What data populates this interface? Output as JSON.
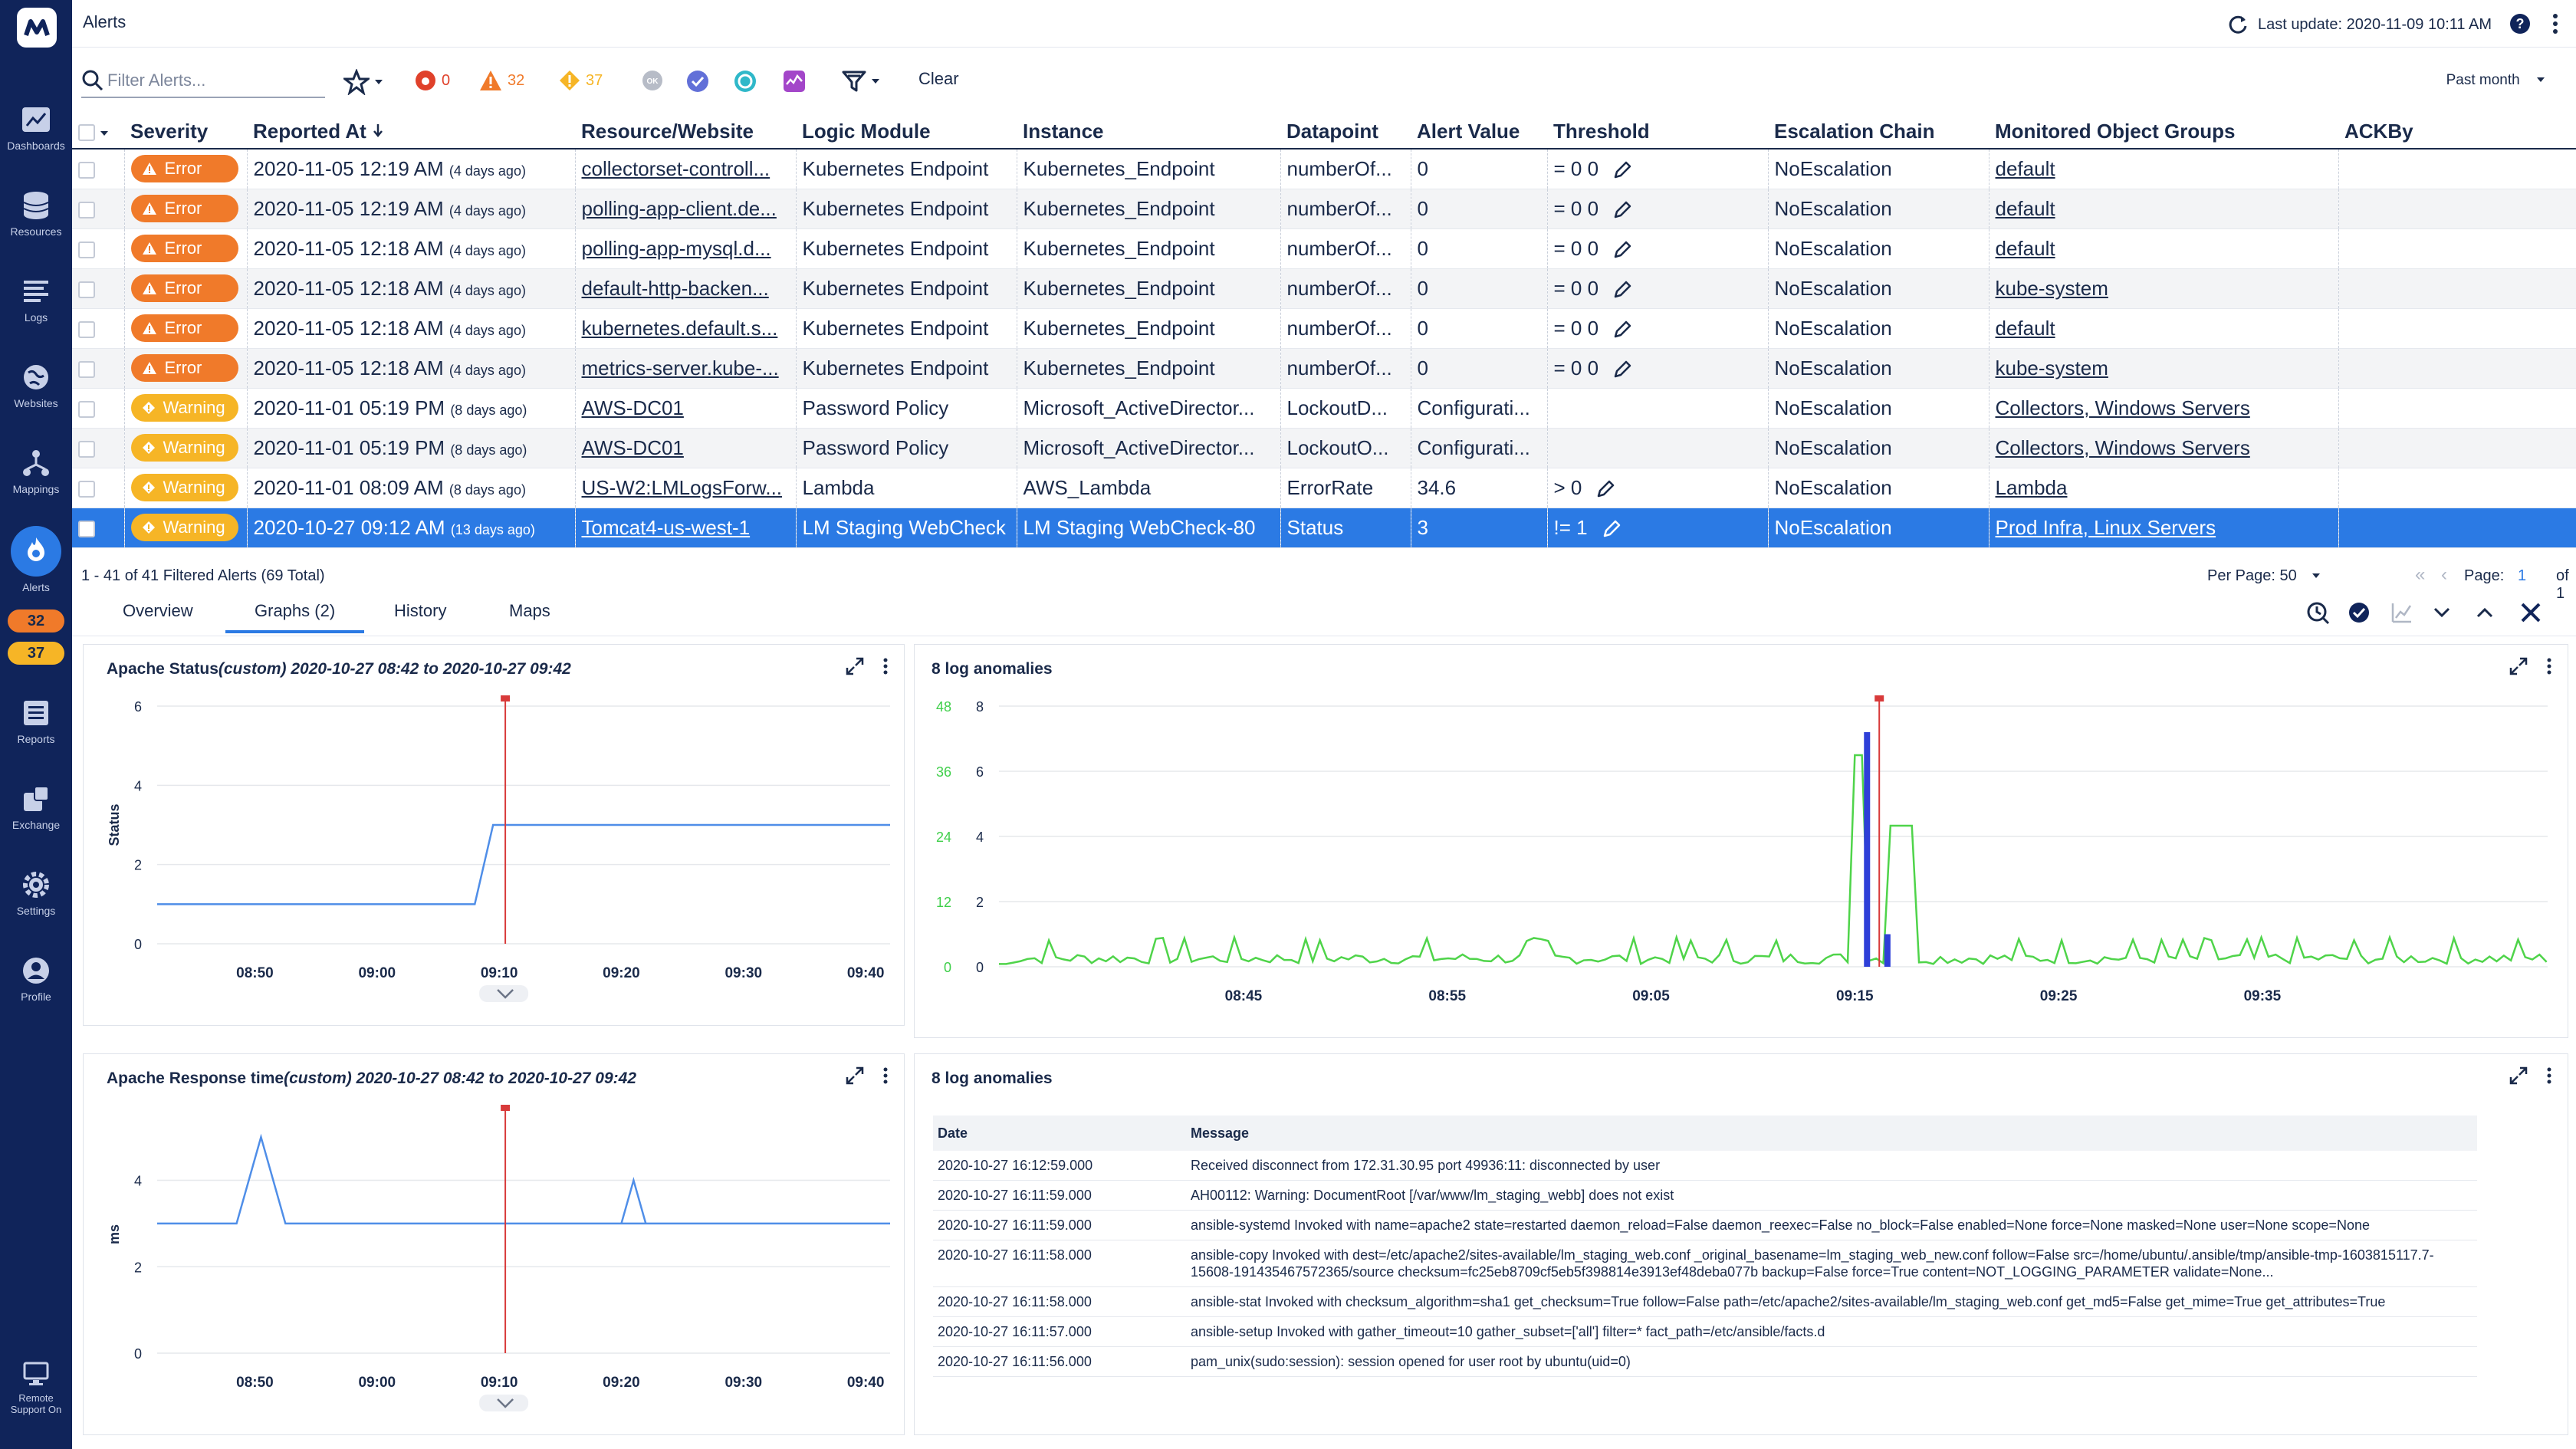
{
  "app": {
    "title": "Alerts",
    "last_update": "Last update: 2020-11-09 10:11 AM"
  },
  "sidebar": {
    "items": [
      {
        "label": "Dashboards"
      },
      {
        "label": "Resources"
      },
      {
        "label": "Logs"
      },
      {
        "label": "Websites"
      },
      {
        "label": "Mappings"
      },
      {
        "label": "Alerts"
      },
      {
        "label": "Reports"
      },
      {
        "label": "Exchange"
      },
      {
        "label": "Settings"
      },
      {
        "label": "Profile"
      },
      {
        "label": "Remote Support On"
      }
    ],
    "badges": {
      "orange": "32",
      "yellow": "37"
    }
  },
  "toolbar": {
    "filter_placeholder": "Filter Alerts...",
    "critical_count": "0",
    "error_count": "32",
    "warning_count": "37",
    "ok_label": "OK",
    "clear_label": "Clear",
    "range_label": "Past month"
  },
  "table": {
    "headers": [
      "Severity",
      "Reported At",
      "Resource/Website",
      "Logic Module",
      "Instance",
      "Datapoint",
      "Alert Value",
      "Threshold",
      "Escalation Chain",
      "Monitored Object Groups",
      "ACKBy"
    ],
    "rows": [
      {
        "sev": "Error",
        "at": "2020-11-05 12:19 AM",
        "ago": "(4 days ago)",
        "res": "collectorset-controll...",
        "lm": "Kubernetes Endpoint",
        "inst": "Kubernetes_Endpoint",
        "dp": "numberOf...",
        "val": "0",
        "thr": "= 0 0",
        "esc": "NoEscalation",
        "grp": "default"
      },
      {
        "sev": "Error",
        "at": "2020-11-05 12:19 AM",
        "ago": "(4 days ago)",
        "res": "polling-app-client.de...",
        "lm": "Kubernetes Endpoint",
        "inst": "Kubernetes_Endpoint",
        "dp": "numberOf...",
        "val": "0",
        "thr": "= 0 0",
        "esc": "NoEscalation",
        "grp": "default"
      },
      {
        "sev": "Error",
        "at": "2020-11-05 12:18 AM",
        "ago": "(4 days ago)",
        "res": "polling-app-mysql.d...",
        "lm": "Kubernetes Endpoint",
        "inst": "Kubernetes_Endpoint",
        "dp": "numberOf...",
        "val": "0",
        "thr": "= 0 0",
        "esc": "NoEscalation",
        "grp": "default"
      },
      {
        "sev": "Error",
        "at": "2020-11-05 12:18 AM",
        "ago": "(4 days ago)",
        "res": "default-http-backen...",
        "lm": "Kubernetes Endpoint",
        "inst": "Kubernetes_Endpoint",
        "dp": "numberOf...",
        "val": "0",
        "thr": "= 0 0",
        "esc": "NoEscalation",
        "grp": "kube-system"
      },
      {
        "sev": "Error",
        "at": "2020-11-05 12:18 AM",
        "ago": "(4 days ago)",
        "res": "kubernetes.default.s...",
        "lm": "Kubernetes Endpoint",
        "inst": "Kubernetes_Endpoint",
        "dp": "numberOf...",
        "val": "0",
        "thr": "= 0 0",
        "esc": "NoEscalation",
        "grp": "default"
      },
      {
        "sev": "Error",
        "at": "2020-11-05 12:18 AM",
        "ago": "(4 days ago)",
        "res": "metrics-server.kube-...",
        "lm": "Kubernetes Endpoint",
        "inst": "Kubernetes_Endpoint",
        "dp": "numberOf...",
        "val": "0",
        "thr": "= 0 0",
        "esc": "NoEscalation",
        "grp": "kube-system"
      },
      {
        "sev": "Warning",
        "at": "2020-11-01 05:19 PM",
        "ago": "(8 days ago)",
        "res": "AWS-DC01",
        "lm": "Password Policy",
        "inst": "Microsoft_ActiveDirector...",
        "dp": "LockoutD...",
        "val": "Configurati...",
        "thr": "",
        "esc": "NoEscalation",
        "grp": "Collectors, Windows Servers"
      },
      {
        "sev": "Warning",
        "at": "2020-11-01 05:19 PM",
        "ago": "(8 days ago)",
        "res": "AWS-DC01",
        "lm": "Password Policy",
        "inst": "Microsoft_ActiveDirector...",
        "dp": "LockoutO...",
        "val": "Configurati...",
        "thr": "",
        "esc": "NoEscalation",
        "grp": "Collectors, Windows Servers"
      },
      {
        "sev": "Warning",
        "at": "2020-11-01 08:09 AM",
        "ago": "(8 days ago)",
        "res": "US-W2:LMLogsForw...",
        "lm": "Lambda",
        "inst": "AWS_Lambda",
        "dp": "ErrorRate",
        "val": "34.6",
        "thr": "> 0",
        "esc": "NoEscalation",
        "grp": "Lambda"
      },
      {
        "sev": "Warning",
        "at": "2020-10-27 09:12 AM",
        "ago": "(13 days ago)",
        "res": "Tomcat4-us-west-1",
        "lm": "LM Staging WebCheck",
        "inst": "LM Staging WebCheck-80",
        "dp": "Status",
        "val": "3",
        "thr": "!= 1",
        "esc": "NoEscalation",
        "grp": "Prod Infra, Linux Servers"
      }
    ]
  },
  "status": {
    "summary": "1 - 41 of 41 Filtered Alerts (69 Total)",
    "per_page": "Per Page: 50",
    "page_label": "Page:",
    "page": "1",
    "of": "of 1"
  },
  "tabs": [
    "Overview",
    "Graphs (2)",
    "History",
    "Maps"
  ],
  "panels": {
    "status_title_pre": "Apache Status",
    "status_title_custom": "(custom)",
    "status_title_range": " 2020-10-27 08:42 to 2020-10-27 09:42",
    "resp_title_pre": "Apache Response time",
    "resp_title_custom": "(custom)",
    "resp_title_range": " 2020-10-27 08:42 to 2020-10-27 09:42",
    "anom_title": "8 log anomalies",
    "log_title": "8 log anomalies",
    "status_ylabel": "Status",
    "resp_ylabel": "ms"
  },
  "chart_data": [
    {
      "type": "line",
      "title": "Apache Status(custom) 2020-10-27 08:42 to 2020-10-27 09:42",
      "ylabel": "Status",
      "x_ticks": [
        "08:50",
        "09:00",
        "09:10",
        "09:20",
        "09:30",
        "09:40"
      ],
      "y_ticks": [
        "0",
        "2",
        "4",
        "6"
      ],
      "ylim": [
        0,
        6
      ],
      "xlim_min": [
        -8,
        52
      ],
      "alert_at_min": 20.5,
      "series": [
        {
          "x": [
            -8,
            18,
            19.5,
            52
          ],
          "y": [
            1,
            1,
            3,
            3
          ]
        }
      ]
    },
    {
      "type": "line",
      "title": "Apache Response time(custom) 2020-10-27 08:42 to 2020-10-27 09:42",
      "ylabel": "ms",
      "x_ticks": [
        "08:50",
        "09:00",
        "09:10",
        "09:20",
        "09:30",
        "09:40"
      ],
      "y_ticks": [
        "0",
        "2",
        "4"
      ],
      "ylim": [
        0,
        5.5
      ],
      "xlim_min": [
        -8,
        52
      ],
      "alert_at_min": 20.5,
      "series": [
        {
          "x": [
            -8,
            -1.5,
            0.5,
            2.5,
            52
          ],
          "y": [
            3,
            3,
            5,
            3,
            3
          ],
          "x2": [
            30,
            31,
            32
          ]
        }
      ]
    },
    {
      "type": "bar",
      "title": "8 log anomalies",
      "x_ticks": [
        "08:45",
        "08:55",
        "09:05",
        "09:15",
        "09:25",
        "09:35"
      ],
      "y_ticks_left": [
        "0",
        "12",
        "24",
        "36",
        "48"
      ],
      "y_ticks_right": [
        "0",
        "2",
        "4",
        "6",
        "8"
      ],
      "anomaly_bars": [
        {
          "x": 30.6,
          "y": 7.2
        },
        {
          "x": 31.6,
          "y": 1
        }
      ],
      "alert_at_min": 31.2
    }
  ],
  "logs": {
    "headers": [
      "Date",
      "Message"
    ],
    "rows": [
      {
        "d": "2020-10-27 16:12:59.000",
        "m": "Received disconnect from 172.31.30.95 port 49936:11: disconnected by user"
      },
      {
        "d": "2020-10-27 16:11:59.000",
        "m": "AH00112: Warning: DocumentRoot [/var/www/lm_staging_webb] does not exist"
      },
      {
        "d": "2020-10-27 16:11:59.000",
        "m": "ansible-systemd Invoked with name=apache2 state=restarted daemon_reload=False daemon_reexec=False no_block=False enabled=None force=None masked=None user=None scope=None"
      },
      {
        "d": "2020-10-27 16:11:58.000",
        "m": "ansible-copy Invoked with dest=/etc/apache2/sites-available/lm_staging_web.conf _original_basename=lm_staging_web_new.conf follow=False src=/home/ubuntu/.ansible/tmp/ansible-tmp-1603815117.7-15608-191435467572365/source checksum=fc25eb8709cf5eb5f398814e3913ef48deba077b backup=False force=True content=NOT_LOGGING_PARAMETER validate=None..."
      },
      {
        "d": "2020-10-27 16:11:58.000",
        "m": "ansible-stat Invoked with checksum_algorithm=sha1 get_checksum=True follow=False path=/etc/apache2/sites-available/lm_staging_web.conf get_md5=False get_mime=True get_attributes=True"
      },
      {
        "d": "2020-10-27 16:11:57.000",
        "m": "ansible-setup Invoked with gather_timeout=10 gather_subset=['all'] filter=* fact_path=/etc/ansible/facts.d"
      },
      {
        "d": "2020-10-27 16:11:56.000",
        "m": "pam_unix(sudo:session): session opened for user root by ubuntu(uid=0)"
      }
    ]
  }
}
